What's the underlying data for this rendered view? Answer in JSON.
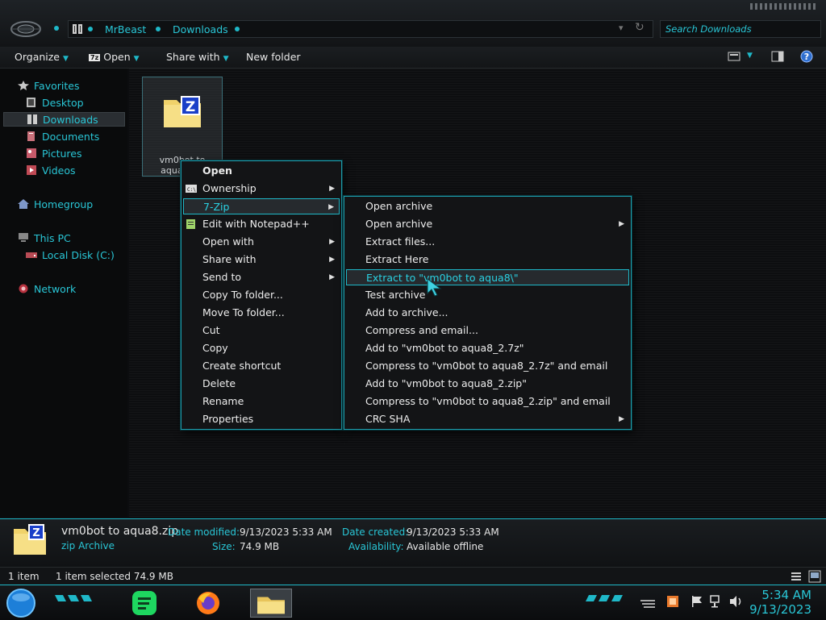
{
  "address": {
    "crumbs": [
      "MrBeast",
      "Downloads"
    ],
    "search_placeholder": "Search Downloads"
  },
  "toolbar": {
    "organize": "Organize",
    "open": "Open",
    "share_with": "Share with",
    "new_folder": "New folder",
    "sevenzip_badge": "7z"
  },
  "nav": {
    "favorites": "Favorites",
    "desktop": "Desktop",
    "downloads": "Downloads",
    "documents": "Documents",
    "pictures": "Pictures",
    "videos": "Videos",
    "homegroup": "Homegroup",
    "this_pc": "This PC",
    "local_disk": "Local Disk (C:)",
    "network": "Network"
  },
  "file": {
    "name_line1": "vm0bot to",
    "name_line2": "aqua8.zip",
    "icon_letter": "Z"
  },
  "context_menu": [
    {
      "label": "Open",
      "bold": true
    },
    {
      "label": "Ownership",
      "submenu": true
    },
    {
      "label": "7-Zip",
      "submenu": true,
      "highlighted": true
    },
    {
      "label": "Edit with Notepad++"
    },
    {
      "label": "Open with",
      "submenu": true
    },
    {
      "label": "Share with",
      "submenu": true
    },
    {
      "label": "Send to",
      "submenu": true
    },
    {
      "label": "Copy To folder..."
    },
    {
      "label": "Move To folder..."
    },
    {
      "label": "Cut"
    },
    {
      "label": "Copy"
    },
    {
      "label": "Create shortcut"
    },
    {
      "label": "Delete"
    },
    {
      "label": "Rename"
    },
    {
      "label": "Properties"
    }
  ],
  "sevenzip_menu": [
    {
      "label": "Open archive"
    },
    {
      "label": "Open archive",
      "submenu": true
    },
    {
      "label": "Extract files..."
    },
    {
      "label": "Extract Here"
    },
    {
      "label": "Extract to \"vm0bot to aqua8\\\"",
      "highlighted": true
    },
    {
      "label": "Test archive"
    },
    {
      "label": "Add to archive..."
    },
    {
      "label": "Compress and email..."
    },
    {
      "label": "Add to \"vm0bot to aqua8_2.7z\""
    },
    {
      "label": "Compress to \"vm0bot to aqua8_2.7z\" and email"
    },
    {
      "label": "Add to \"vm0bot to aqua8_2.zip\""
    },
    {
      "label": "Compress to \"vm0bot to aqua8_2.zip\" and email"
    },
    {
      "label": "CRC SHA",
      "submenu": true
    }
  ],
  "details": {
    "name": "vm0bot to aqua8.zip",
    "type": "zip Archive",
    "date_modified_label": "Date modified:",
    "date_modified": "9/13/2023 5:33 AM",
    "size_label": "Size:",
    "size": "74.9 MB",
    "date_created_label": "Date created:",
    "date_created": "9/13/2023 5:33 AM",
    "availability_label": "Availability:",
    "availability": "Available offline"
  },
  "status": {
    "items": "1 item",
    "selected": "1 item selected  74.9 MB"
  },
  "taskbar": {
    "time": "5:34 AM",
    "date": "9/13/2023"
  },
  "colors": {
    "accent": "#1fb8c8",
    "link": "#29c6d6",
    "menu_bg": "#131416"
  }
}
